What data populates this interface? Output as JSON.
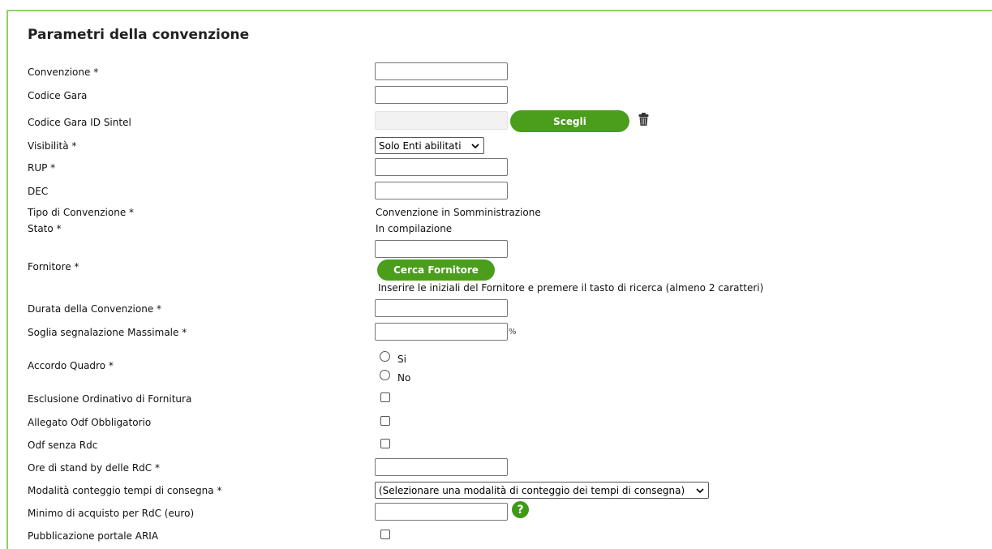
{
  "section": {
    "title": "Parametri della convenzione"
  },
  "fields": {
    "convenzione": {
      "label": "Convenzione *",
      "value": ""
    },
    "codice_gara": {
      "label": "Codice Gara",
      "value": ""
    },
    "codice_gara_sintel": {
      "label": "Codice Gara ID Sintel",
      "value": "",
      "button": "Scegli"
    },
    "visibilita": {
      "label": "Visibilità *",
      "selected": "Solo Enti abilitati"
    },
    "rup": {
      "label": "RUP *",
      "value": ""
    },
    "dec": {
      "label": "DEC",
      "value": ""
    },
    "tipo_convenzione": {
      "label": "Tipo di Convenzione *",
      "value": "Convenzione in Somministrazione"
    },
    "stato": {
      "label": "Stato *",
      "value": "In compilazione"
    },
    "fornitore": {
      "label": "Fornitore *",
      "value": "",
      "button": "Cerca Fornitore",
      "hint": "Inserire le iniziali del Fornitore e premere il tasto di ricerca (almeno 2 caratteri)"
    },
    "durata": {
      "label": "Durata della Convenzione *",
      "value": ""
    },
    "soglia": {
      "label": "Soglia segnalazione Massimale *",
      "value": "",
      "unit": "%"
    },
    "accordo_quadro": {
      "label": "Accordo Quadro *",
      "options": [
        "Si",
        "No"
      ]
    },
    "esclusione_odf": {
      "label": "Esclusione Ordinativo di Fornitura",
      "checked": false
    },
    "allegato_odf": {
      "label": "Allegato Odf Obbligatorio",
      "checked": false
    },
    "odf_senza_rdc": {
      "label": "Odf senza Rdc",
      "checked": false
    },
    "ore_standby": {
      "label": "Ore di stand by delle RdC *",
      "value": ""
    },
    "modalita_conteggio": {
      "label": "Modalità conteggio tempi di consegna *",
      "selected": "(Selezionare una modalità di conteggio dei tempi di consegna)"
    },
    "minimo_acquisto": {
      "label": "Minimo di acquisto per RdC (euro)",
      "value": "",
      "help": "?"
    },
    "pubblicazione_aria": {
      "label": "Pubblicazione portale ARIA",
      "checked": false
    }
  },
  "colors": {
    "accent_green": "#4a9e1c",
    "border_green": "#8fd16b"
  },
  "icons": {
    "delete": "trash-icon",
    "help": "help-icon",
    "dropdown": "chevron-down-icon"
  }
}
